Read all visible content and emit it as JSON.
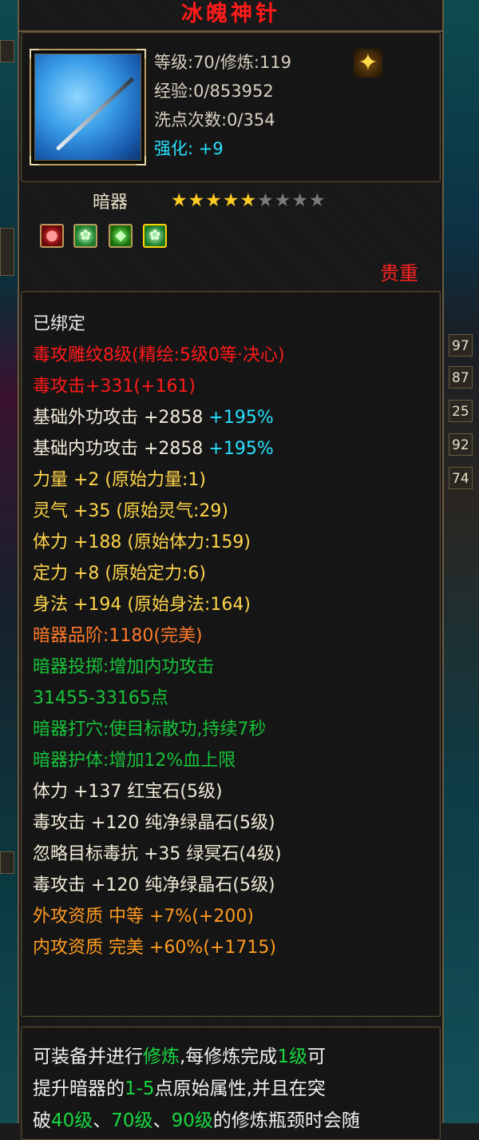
{
  "side": {
    "numbers": [
      "97",
      "87",
      "25",
      "92",
      "74"
    ]
  },
  "item": {
    "name": "冰魄神针",
    "level_line": "等级:70/修炼:119",
    "exp_line": "经验:0/853952",
    "reset_line": "洗点次数:0/354",
    "enhance_label": "强化:",
    "enhance_value": " +9",
    "type": "暗器",
    "stars_total": 9,
    "stars_filled": 5,
    "gems": [
      "red-gem-icon",
      "green-gem-icon",
      "green-leaf-gem-icon",
      "gold-green-gem-icon"
    ],
    "rarity": "贵重"
  },
  "stats": {
    "bound": "已绑定",
    "carving": "毒攻雕纹8级(精绘:5级0等·决心)",
    "poison_attack": "毒攻击+331(+161)",
    "ext_attack_label": "基础外功攻击 +2858",
    "ext_attack_pct": " +195%",
    "int_attack_label": "基础内功攻击 +2858",
    "int_attack_pct": " +195%",
    "strength": "力量 +2 (原始力量:1)",
    "spirit": "灵气 +35 (原始灵气:29)",
    "vitality": "体力 +188 (原始体力:159)",
    "focus": "定力 +8 (原始定力:6)",
    "agility": "身法 +194 (原始身法:164)",
    "grade": "暗器品阶:1180(完美)",
    "throw_line1": "暗器投掷:增加内功攻击",
    "throw_line2": "31455-33165点",
    "acupoint": "暗器打穴:使目标散功,持续7秒",
    "guard": "暗器护体:增加12%血上限",
    "gem1": "体力 +137 红宝石(5级)",
    "gem2": "毒攻击 +120 纯净绿晶石(5级)",
    "gem3": "忽略目标毒抗 +35 绿冥石(4级)",
    "gem4": "毒攻击 +120 纯净绿晶石(5级)",
    "ext_quality": "外攻资质  中等 +7%(+200)",
    "int_quality": "内攻资质  完美 +60%(+1715)"
  },
  "description": {
    "l1_a": "可装备并进行",
    "l1_b": "修炼",
    "l1_c": ",每修炼完成",
    "l1_d": "1级",
    "l1_e": "可",
    "l2_a": "提升暗器的",
    "l2_b": "1-5",
    "l2_c": "点原始属性,并且在突",
    "l3_a": "破",
    "l3_b": "40级",
    "l3_c": "、",
    "l3_d": "70级",
    "l3_e": "、",
    "l3_f": "90级",
    "l3_g": "的修炼瓶颈时会随"
  },
  "colors": {
    "title": "#ff1a1a",
    "enhance": "#27e0ff",
    "rarity": "#ff2222",
    "green_text": "#18c23a",
    "gold_text": "#ffd54a"
  }
}
